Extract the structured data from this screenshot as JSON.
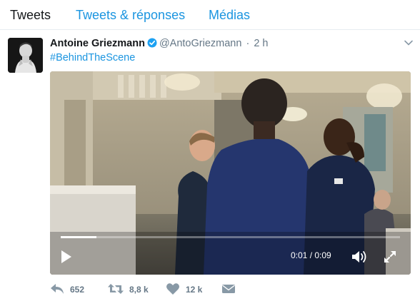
{
  "tabs": [
    {
      "label": "Tweets",
      "active": true
    },
    {
      "label": "Tweets & réponses",
      "active": false
    },
    {
      "label": "Médias",
      "active": false
    }
  ],
  "tweet": {
    "author_name": "Antoine Griezmann",
    "verified": true,
    "handle": "@AntoGriezmann",
    "separator": "·",
    "time": "2 h",
    "hashtag": "#BehindTheScene"
  },
  "video": {
    "current_time": "0:01",
    "duration": "0:09",
    "timecode": "0:01 / 0:09",
    "progress_fraction": 0.105
  },
  "actions": {
    "replies": "652",
    "retweets": "8,8 k",
    "likes": "12 k"
  },
  "colors": {
    "link_blue": "#1b95e0",
    "muted_gray": "#657786",
    "verified_blue": "#1da1f2"
  },
  "icons": [
    "chevron-down-icon",
    "verified-badge-icon",
    "play-icon",
    "volume-icon",
    "fullscreen-icon",
    "reply-icon",
    "retweet-icon",
    "like-icon",
    "direct-message-icon"
  ]
}
